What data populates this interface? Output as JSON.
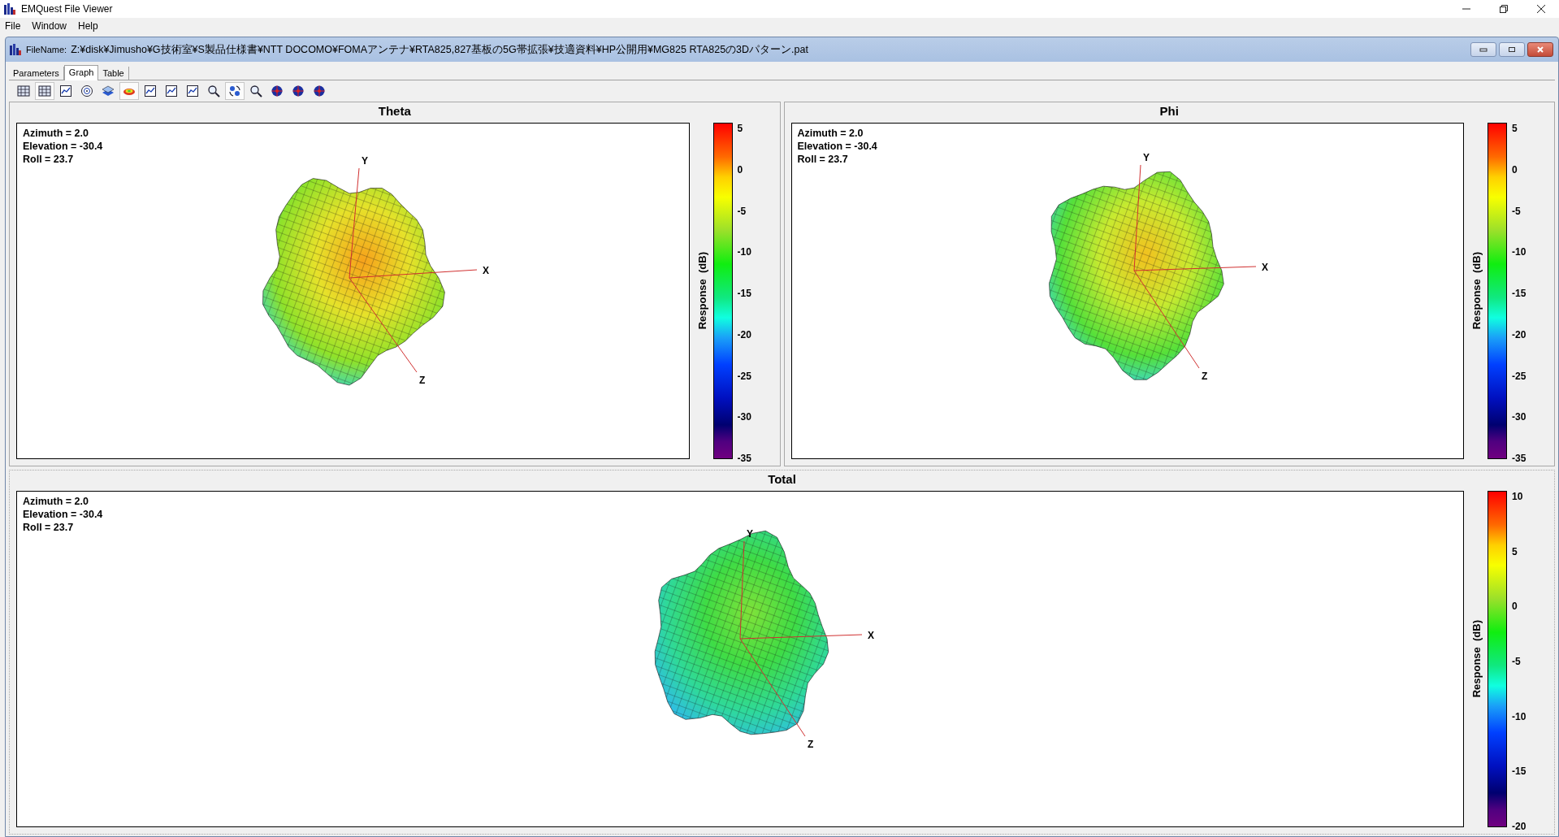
{
  "window": {
    "title": "EMQuest File Viewer"
  },
  "menu": [
    "File",
    "Window",
    "Help"
  ],
  "document": {
    "label": "FileName:",
    "path": "Z:¥disk¥Jimusho¥G技術室¥S製品仕様書¥NTT DOCOMO¥FOMAアンテナ¥RTA825,827基板の5G帯拡張¥技適資料¥HP公開用¥MG825 RTA825の3Dパターン.pat"
  },
  "tabs": [
    {
      "label": "Parameters",
      "selected": false
    },
    {
      "label": "Graph",
      "selected": true
    },
    {
      "label": "Table",
      "selected": false
    }
  ],
  "tools": [
    {
      "selected": false
    },
    {
      "selected": true
    },
    {
      "selected": false
    },
    {
      "selected": false
    },
    {
      "selected": false
    },
    {
      "selected": true
    },
    {
      "selected": false
    },
    {
      "selected": false
    },
    {
      "selected": false
    },
    {
      "selected": false
    },
    {
      "selected": true
    },
    {
      "selected": false
    },
    {
      "selected": false
    },
    {
      "selected": false
    },
    {
      "selected": false
    }
  ],
  "panels": [
    {
      "title": "Theta",
      "info": [
        "Azimuth = 2.0",
        "Elevation = -30.4",
        "Roll = 23.7"
      ],
      "axes": [
        "Y",
        "X",
        "Z"
      ],
      "colorbar": {
        "label": "Response  (dB)",
        "ticks": [
          "5",
          "0",
          "-5",
          "-10",
          "-15",
          "-20",
          "-25",
          "-30",
          "-35"
        ]
      }
    },
    {
      "title": "Phi",
      "info": [
        "Azimuth = 2.0",
        "Elevation = -30.4",
        "Roll = 23.7"
      ],
      "axes": [
        "Y",
        "X",
        "Z"
      ],
      "colorbar": {
        "label": "Response  (dB)",
        "ticks": [
          "5",
          "0",
          "-5",
          "-10",
          "-15",
          "-20",
          "-25",
          "-30",
          "-35"
        ]
      }
    },
    {
      "title": "Total",
      "info": [
        "Azimuth = 2.0",
        "Elevation = -30.4",
        "Roll = 23.7"
      ],
      "axes": [
        "Y",
        "X",
        "Z"
      ],
      "colorbar": {
        "label": "Response  (dB)",
        "ticks": [
          "10",
          "5",
          "0",
          "-5",
          "-10",
          "-15",
          "-20"
        ]
      }
    }
  ]
}
